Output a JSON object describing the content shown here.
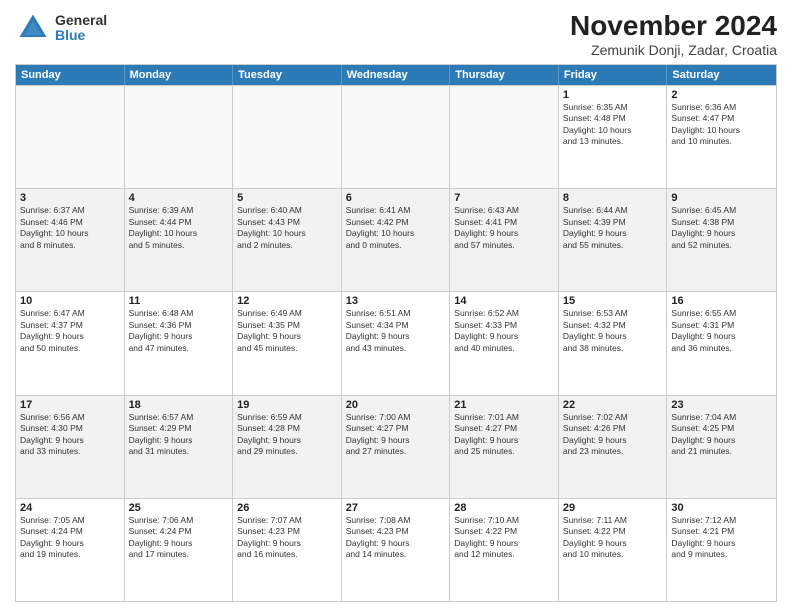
{
  "logo": {
    "general": "General",
    "blue": "Blue"
  },
  "title": "November 2024",
  "subtitle": "Zemunik Donji, Zadar, Croatia",
  "header_days": [
    "Sunday",
    "Monday",
    "Tuesday",
    "Wednesday",
    "Thursday",
    "Friday",
    "Saturday"
  ],
  "rows": [
    [
      {
        "day": "",
        "info": "",
        "empty": true
      },
      {
        "day": "",
        "info": "",
        "empty": true
      },
      {
        "day": "",
        "info": "",
        "empty": true
      },
      {
        "day": "",
        "info": "",
        "empty": true
      },
      {
        "day": "",
        "info": "",
        "empty": true
      },
      {
        "day": "1",
        "info": "Sunrise: 6:35 AM\nSunset: 4:48 PM\nDaylight: 10 hours\nand 13 minutes.",
        "empty": false
      },
      {
        "day": "2",
        "info": "Sunrise: 6:36 AM\nSunset: 4:47 PM\nDaylight: 10 hours\nand 10 minutes.",
        "empty": false
      }
    ],
    [
      {
        "day": "3",
        "info": "Sunrise: 6:37 AM\nSunset: 4:46 PM\nDaylight: 10 hours\nand 8 minutes.",
        "empty": false
      },
      {
        "day": "4",
        "info": "Sunrise: 6:39 AM\nSunset: 4:44 PM\nDaylight: 10 hours\nand 5 minutes.",
        "empty": false
      },
      {
        "day": "5",
        "info": "Sunrise: 6:40 AM\nSunset: 4:43 PM\nDaylight: 10 hours\nand 2 minutes.",
        "empty": false
      },
      {
        "day": "6",
        "info": "Sunrise: 6:41 AM\nSunset: 4:42 PM\nDaylight: 10 hours\nand 0 minutes.",
        "empty": false
      },
      {
        "day": "7",
        "info": "Sunrise: 6:43 AM\nSunset: 4:41 PM\nDaylight: 9 hours\nand 57 minutes.",
        "empty": false
      },
      {
        "day": "8",
        "info": "Sunrise: 6:44 AM\nSunset: 4:39 PM\nDaylight: 9 hours\nand 55 minutes.",
        "empty": false
      },
      {
        "day": "9",
        "info": "Sunrise: 6:45 AM\nSunset: 4:38 PM\nDaylight: 9 hours\nand 52 minutes.",
        "empty": false
      }
    ],
    [
      {
        "day": "10",
        "info": "Sunrise: 6:47 AM\nSunset: 4:37 PM\nDaylight: 9 hours\nand 50 minutes.",
        "empty": false
      },
      {
        "day": "11",
        "info": "Sunrise: 6:48 AM\nSunset: 4:36 PM\nDaylight: 9 hours\nand 47 minutes.",
        "empty": false
      },
      {
        "day": "12",
        "info": "Sunrise: 6:49 AM\nSunset: 4:35 PM\nDaylight: 9 hours\nand 45 minutes.",
        "empty": false
      },
      {
        "day": "13",
        "info": "Sunrise: 6:51 AM\nSunset: 4:34 PM\nDaylight: 9 hours\nand 43 minutes.",
        "empty": false
      },
      {
        "day": "14",
        "info": "Sunrise: 6:52 AM\nSunset: 4:33 PM\nDaylight: 9 hours\nand 40 minutes.",
        "empty": false
      },
      {
        "day": "15",
        "info": "Sunrise: 6:53 AM\nSunset: 4:32 PM\nDaylight: 9 hours\nand 38 minutes.",
        "empty": false
      },
      {
        "day": "16",
        "info": "Sunrise: 6:55 AM\nSunset: 4:31 PM\nDaylight: 9 hours\nand 36 minutes.",
        "empty": false
      }
    ],
    [
      {
        "day": "17",
        "info": "Sunrise: 6:56 AM\nSunset: 4:30 PM\nDaylight: 9 hours\nand 33 minutes.",
        "empty": false
      },
      {
        "day": "18",
        "info": "Sunrise: 6:57 AM\nSunset: 4:29 PM\nDaylight: 9 hours\nand 31 minutes.",
        "empty": false
      },
      {
        "day": "19",
        "info": "Sunrise: 6:59 AM\nSunset: 4:28 PM\nDaylight: 9 hours\nand 29 minutes.",
        "empty": false
      },
      {
        "day": "20",
        "info": "Sunrise: 7:00 AM\nSunset: 4:27 PM\nDaylight: 9 hours\nand 27 minutes.",
        "empty": false
      },
      {
        "day": "21",
        "info": "Sunrise: 7:01 AM\nSunset: 4:27 PM\nDaylight: 9 hours\nand 25 minutes.",
        "empty": false
      },
      {
        "day": "22",
        "info": "Sunrise: 7:02 AM\nSunset: 4:26 PM\nDaylight: 9 hours\nand 23 minutes.",
        "empty": false
      },
      {
        "day": "23",
        "info": "Sunrise: 7:04 AM\nSunset: 4:25 PM\nDaylight: 9 hours\nand 21 minutes.",
        "empty": false
      }
    ],
    [
      {
        "day": "24",
        "info": "Sunrise: 7:05 AM\nSunset: 4:24 PM\nDaylight: 9 hours\nand 19 minutes.",
        "empty": false
      },
      {
        "day": "25",
        "info": "Sunrise: 7:06 AM\nSunset: 4:24 PM\nDaylight: 9 hours\nand 17 minutes.",
        "empty": false
      },
      {
        "day": "26",
        "info": "Sunrise: 7:07 AM\nSunset: 4:23 PM\nDaylight: 9 hours\nand 16 minutes.",
        "empty": false
      },
      {
        "day": "27",
        "info": "Sunrise: 7:08 AM\nSunset: 4:23 PM\nDaylight: 9 hours\nand 14 minutes.",
        "empty": false
      },
      {
        "day": "28",
        "info": "Sunrise: 7:10 AM\nSunset: 4:22 PM\nDaylight: 9 hours\nand 12 minutes.",
        "empty": false
      },
      {
        "day": "29",
        "info": "Sunrise: 7:11 AM\nSunset: 4:22 PM\nDaylight: 9 hours\nand 10 minutes.",
        "empty": false
      },
      {
        "day": "30",
        "info": "Sunrise: 7:12 AM\nSunset: 4:21 PM\nDaylight: 9 hours\nand 9 minutes.",
        "empty": false
      }
    ]
  ]
}
